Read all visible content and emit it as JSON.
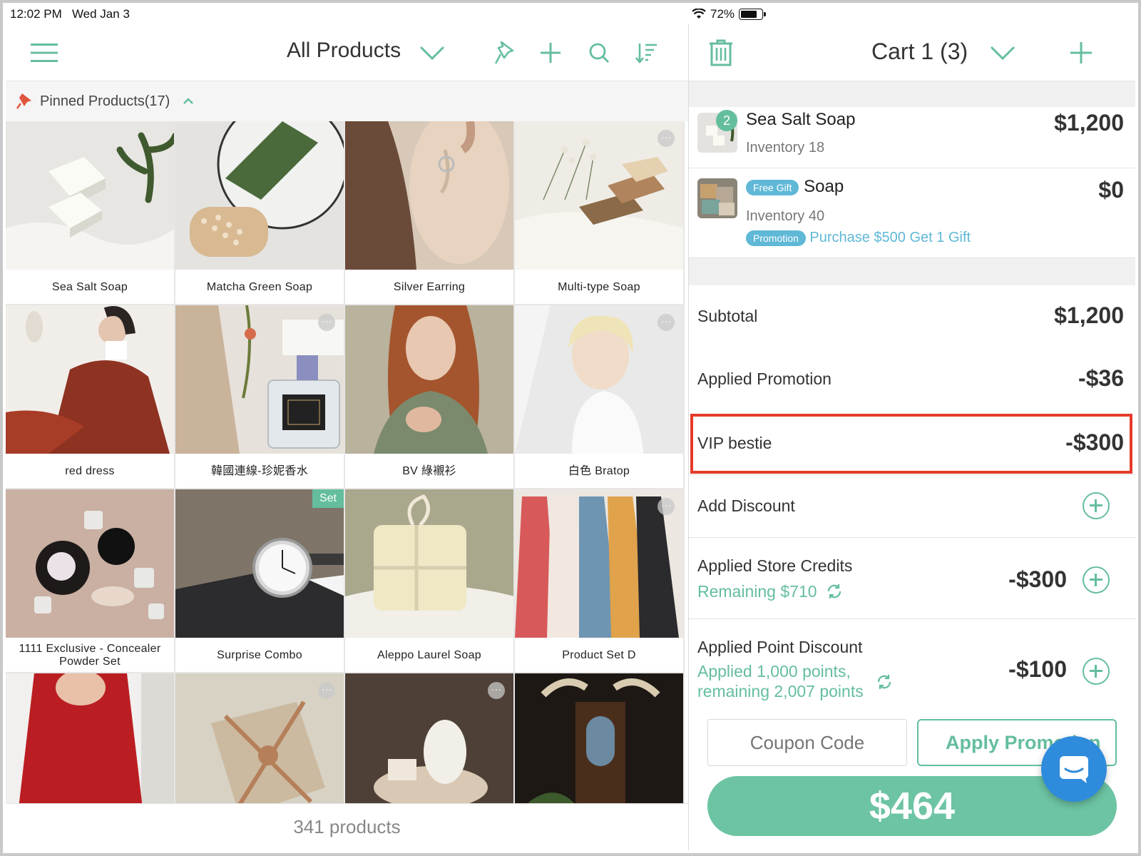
{
  "status_bar": {
    "time": "12:02 PM",
    "date": "Wed Jan 3",
    "battery": "72%"
  },
  "left_panel": {
    "title": "All Products",
    "pinned_label": "Pinned Products(17)",
    "product_count": "341 products",
    "products": [
      {
        "name": "Sea Salt Soap"
      },
      {
        "name": "Matcha Green Soap"
      },
      {
        "name": "Silver Earring"
      },
      {
        "name": "Multi-type Soap"
      },
      {
        "name": "red dress"
      },
      {
        "name": "韓國連線-珍妮香水"
      },
      {
        "name": "BV 綠襯衫"
      },
      {
        "name": "白色 Bratop"
      },
      {
        "name": "1111 Exclusive - Concealer Powder Set"
      },
      {
        "name": "Surprise Combo",
        "badge": "Set"
      },
      {
        "name": "Aleppo Laurel Soap"
      },
      {
        "name": "Product Set D"
      },
      {
        "name": ""
      },
      {
        "name": ""
      },
      {
        "name": ""
      },
      {
        "name": ""
      }
    ]
  },
  "cart": {
    "title": "Cart 1 (3)",
    "items": [
      {
        "name": "Sea Salt Soap",
        "qty": "2",
        "inventory": "Inventory 18",
        "price": "$1,200"
      },
      {
        "name": "Soap",
        "tag": "Free Gift",
        "inventory": "Inventory 40",
        "promo_tag": "Promotion",
        "promo_text": "Purchase $500 Get 1 Gift",
        "price": "$0"
      }
    ],
    "subtotal_label": "Subtotal",
    "subtotal_value": "$1,200",
    "promotion_label": "Applied Promotion",
    "promotion_value": "-$36",
    "vip_label": "VIP bestie",
    "vip_value": "-$300",
    "add_discount_label": "Add Discount",
    "store_credits_label": "Applied Store Credits",
    "store_credits_remaining": "Remaining $710",
    "store_credits_value": "-$300",
    "point_discount_label": "Applied Point Discount",
    "point_discount_line1": "Applied 1,000 points,",
    "point_discount_line2": "remaining 2,007 points",
    "point_discount_value": "-$100",
    "coupon_placeholder": "Coupon Code",
    "apply_label": "Apply Promotion",
    "total": "$464"
  },
  "colors": {
    "accent": "#64be9d",
    "promo": "#5fb8d6",
    "highlight": "#e53b2a",
    "chat": "#2f8bdc"
  }
}
